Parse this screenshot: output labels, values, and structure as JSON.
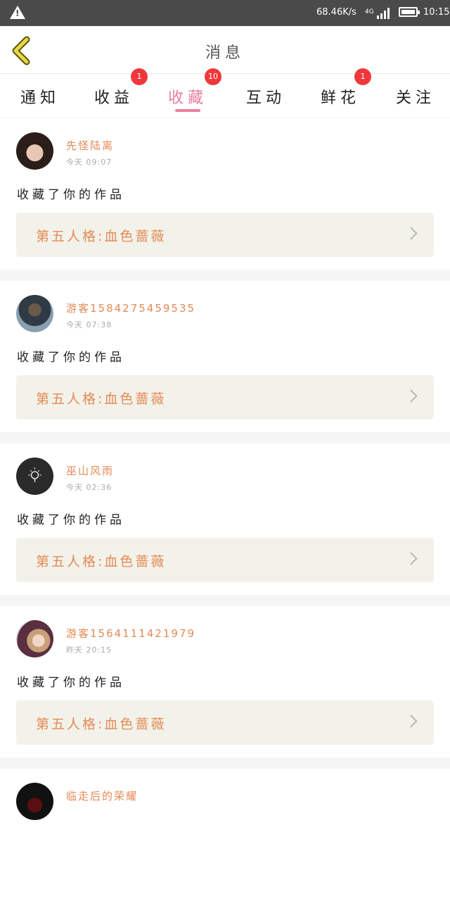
{
  "status_bar": {
    "speed": "68.46K/s",
    "network": "4G",
    "time": "10:15"
  },
  "header": {
    "title": "消息"
  },
  "tabs": [
    {
      "label": "通知",
      "badge": ""
    },
    {
      "label": "收益",
      "badge": "1"
    },
    {
      "label": "收藏",
      "badge": "10"
    },
    {
      "label": "互动",
      "badge": ""
    },
    {
      "label": "鲜花",
      "badge": "1"
    },
    {
      "label": "关注",
      "badge": ""
    }
  ],
  "active_tab": "收藏",
  "colors": {
    "accent": "#e97f9e",
    "username": "#e58a55",
    "badge": "#f0383c",
    "work_box_bg": "#f2f2ea"
  },
  "messages": [
    {
      "username": "先怪陆离",
      "time": "今天 09:07",
      "action": "收藏了你的作品",
      "work_title": "第五人格:血色蔷薇"
    },
    {
      "username": "游客1584275459535",
      "time": "今天 07:38",
      "action": "收藏了你的作品",
      "work_title": "第五人格:血色蔷薇"
    },
    {
      "username": "巫山风雨",
      "time": "今天 02:36",
      "action": "收藏了你的作品",
      "work_title": "第五人格:血色蔷薇"
    },
    {
      "username": "游客1564111421979",
      "time": "昨天 20:15",
      "action": "收藏了你的作品",
      "work_title": "第五人格:血色蔷薇"
    },
    {
      "username": "临走后的荣耀",
      "time": "",
      "action": "",
      "work_title": ""
    }
  ]
}
